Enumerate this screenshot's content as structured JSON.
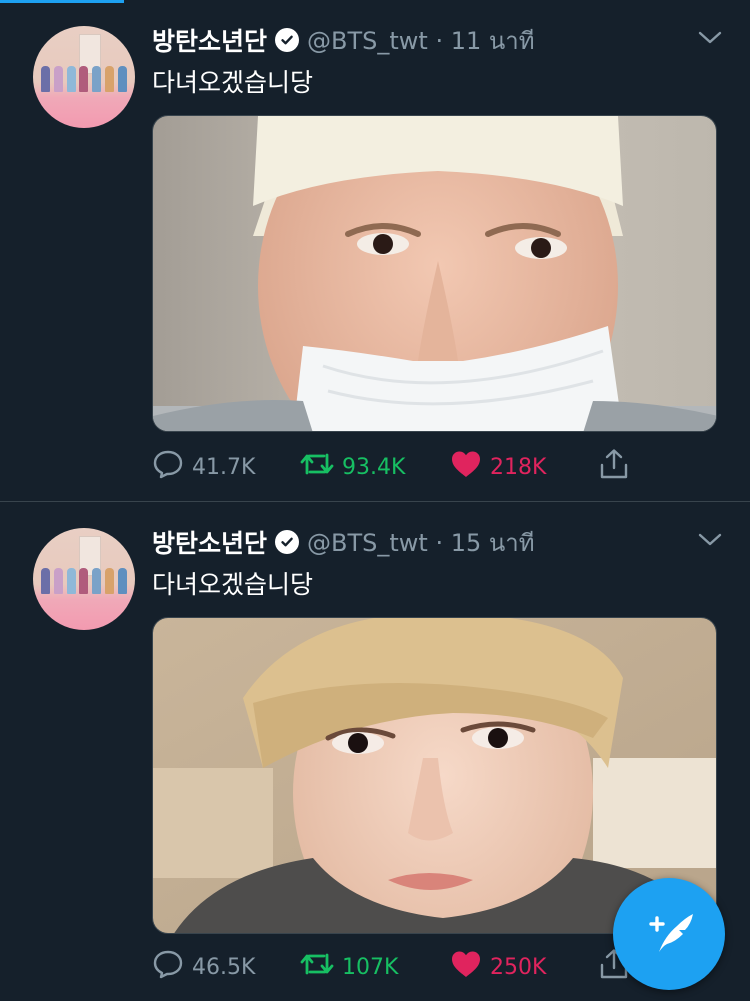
{
  "colors": {
    "background": "#15202b",
    "accent": "#1da1f2",
    "retweet": "#17bf63",
    "like": "#e0245e",
    "muted": "#8899a6"
  },
  "tweets": [
    {
      "name": "방탄소년단",
      "handle": "@BTS_twt · 11 นาที",
      "text": "다녀오겠습니당",
      "replies": "41.7K",
      "retweets": "93.4K",
      "likes": "218K"
    },
    {
      "name": "방탄소년단",
      "handle": "@BTS_twt · 15 นาที",
      "text": "다녀오겠습니당",
      "replies": "46.5K",
      "retweets": "107K",
      "likes": "250K"
    }
  ],
  "icons": [
    "verified-icon",
    "chevron-down-icon",
    "reply-icon",
    "retweet-icon",
    "like-icon",
    "share-icon",
    "compose-icon"
  ]
}
